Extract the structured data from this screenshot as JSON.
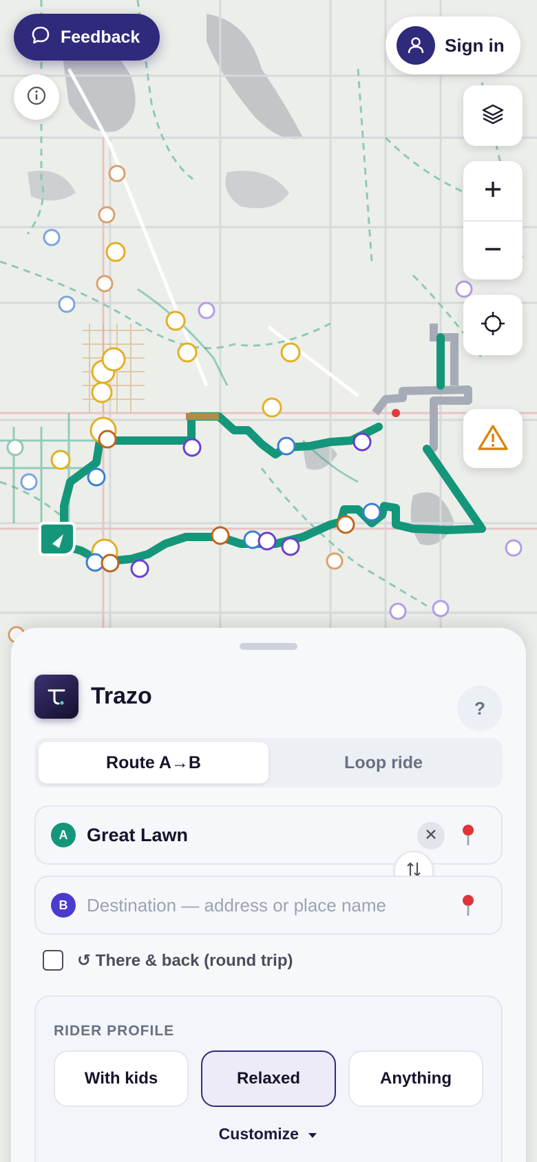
{
  "app": {
    "title": "Trazo"
  },
  "header": {
    "feedback_label": "Feedback",
    "signin_label": "Sign in"
  },
  "controls": {
    "icons": [
      "info-icon",
      "layers-icon",
      "zoom-in-icon",
      "zoom-out-icon",
      "locate-icon",
      "warning-icon"
    ]
  },
  "mode_tabs": [
    {
      "label": "Route A→B",
      "active": true
    },
    {
      "label": "Loop ride",
      "active": false
    }
  ],
  "start": {
    "marker": "A",
    "value": "Great Lawn"
  },
  "destination": {
    "marker": "B",
    "placeholder": "Destination — address or place name",
    "value": ""
  },
  "round_trip": {
    "label": "↺ There & back (round trip)",
    "checked": false
  },
  "rider_profile": {
    "title": "RIDER PROFILE",
    "options": [
      {
        "label": "With kids",
        "selected": false
      },
      {
        "label": "Relaxed",
        "selected": true
      },
      {
        "label": "Anything",
        "selected": false
      }
    ],
    "customize_label": "Customize"
  },
  "help_label": "?",
  "colors": {
    "brand": "#2f2a7c",
    "route": "#14967a",
    "start_marker": "#14967a",
    "end_marker": "#4a3ad0",
    "warning": "#d9870a"
  }
}
